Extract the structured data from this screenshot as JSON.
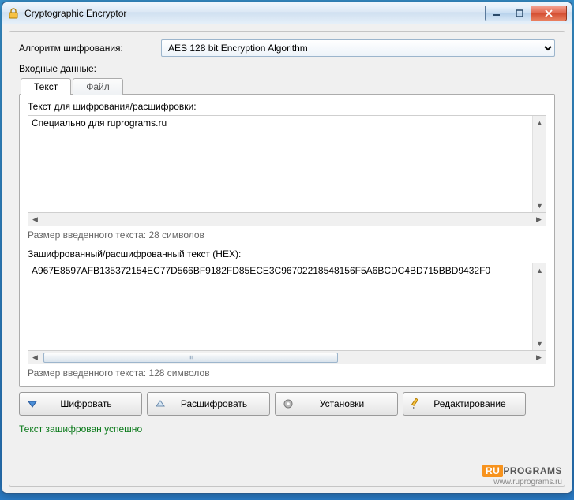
{
  "window": {
    "title": "Cryptographic Encryptor"
  },
  "algorithm": {
    "label": "Алгоритм шифрования:",
    "selected": "AES 128 bit Encryption Algorithm"
  },
  "input_data_label": "Входные данные:",
  "tabs": {
    "text": "Текст",
    "file": "Файл"
  },
  "plain": {
    "label": "Текст для шифрования/расшифровки:",
    "value": "Специально для ruprograms.ru",
    "size_label": "Размер введенного текста: 28 символов"
  },
  "cipher": {
    "label": "Зашифрованный/расшифрованный текст (HEX):",
    "value": "A967E8597AFB135372154EC77D566BF9182FD85ECE3C96702218548156F5A6BCDC4BD715BBD9432F0",
    "size_label": "Размер введенного текста: 128 символов"
  },
  "buttons": {
    "encrypt": "Шифровать",
    "decrypt": "Расшифровать",
    "settings": "Установки",
    "edit": "Редактирование"
  },
  "status": "Текст зашифрован успешно",
  "footer": {
    "brand_ru": "RU",
    "brand_programs": "PROGRAMS",
    "url": "www.ruprograms.ru"
  }
}
